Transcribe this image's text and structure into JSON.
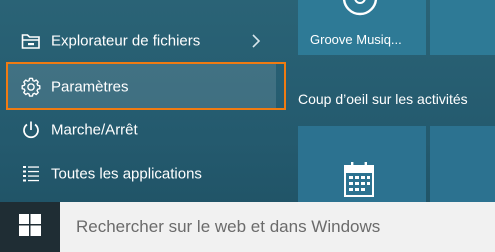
{
  "start_menu": {
    "items": [
      {
        "label": "Explorateur de fichiers",
        "icon": "file-explorer-icon",
        "has_submenu": true
      },
      {
        "label": "Paramètres",
        "icon": "gear-icon",
        "highlighted": true
      },
      {
        "label": "Marche/Arrêt",
        "icon": "power-icon"
      },
      {
        "label": "Toutes les applications",
        "icon": "all-apps-icon"
      }
    ],
    "highlight_color": "#f07b12"
  },
  "tiles": {
    "groove_label": "Groove Musiq...",
    "activity_label": "Coup d’oeil sur les activités",
    "calendar_icon": "calendar-icon"
  },
  "taskbar": {
    "start_icon": "windows-logo-icon",
    "search_placeholder": "Rechercher sur le web et dans Windows"
  }
}
